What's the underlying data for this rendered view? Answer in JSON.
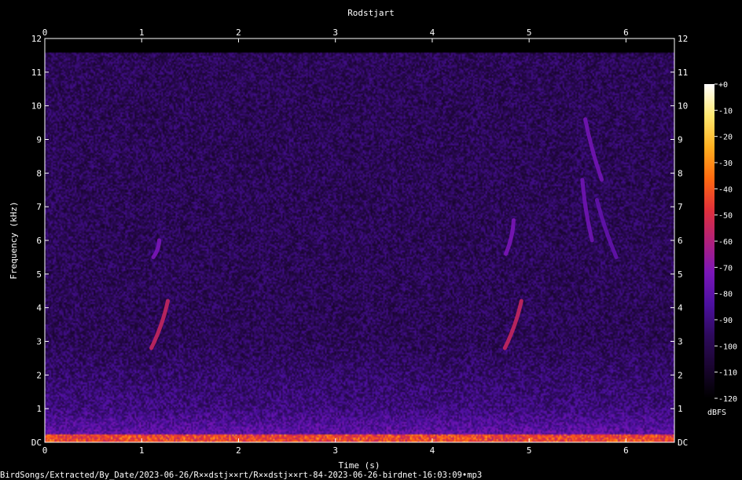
{
  "chart_data": {
    "type": "heatmap",
    "title": "Rodstjart",
    "xlabel": "Time (s)",
    "ylabel": "Frequency (kHz)",
    "xlim": [
      0,
      6.5
    ],
    "ylim": [
      0,
      12
    ],
    "x_ticks": [
      "0",
      "1",
      "2",
      "3",
      "4",
      "5",
      "6"
    ],
    "x_tick_values": [
      0,
      1,
      2,
      3,
      4,
      5,
      6
    ],
    "y_ticks": [
      "DC",
      "1",
      "2",
      "3",
      "4",
      "5",
      "6",
      "7",
      "8",
      "9",
      "10",
      "11",
      "12"
    ],
    "y_tick_values": [
      0,
      1,
      2,
      3,
      4,
      5,
      6,
      7,
      8,
      9,
      10,
      11,
      12
    ],
    "signal_top_khz": 11.6,
    "colorbar": {
      "unit": "dBFS",
      "range": [
        -120,
        0
      ],
      "tick_labels": [
        "+0",
        "-10",
        "-20",
        "-30",
        "-40",
        "-50",
        "-60",
        "-70",
        "-80",
        "-90",
        "-100",
        "-110",
        "-120"
      ],
      "tick_values": [
        0,
        -10,
        -20,
        -30,
        -40,
        -50,
        -60,
        -70,
        -80,
        -90,
        -100,
        -110,
        -120
      ],
      "colormap": [
        "#000000",
        "#1a0530",
        "#2d0a5c",
        "#4c10a0",
        "#7a16b8",
        "#b0207a",
        "#e0303a",
        "#ff6a10",
        "#ffb020",
        "#ffe870",
        "#ffffff"
      ]
    },
    "calls": [
      {
        "t0": 1.1,
        "f0": 2.8,
        "t1": 1.27,
        "f1": 4.2,
        "level_db": -55
      },
      {
        "t0": 1.12,
        "f0": 5.5,
        "t1": 1.18,
        "f1": 6.0,
        "level_db": -72
      },
      {
        "t0": 4.75,
        "f0": 2.8,
        "t1": 4.92,
        "f1": 4.2,
        "level_db": -55
      },
      {
        "t0": 4.76,
        "f0": 5.6,
        "t1": 4.84,
        "f1": 6.6,
        "level_db": -72
      },
      {
        "t0": 5.58,
        "f0": 9.6,
        "t1": 5.75,
        "f1": 7.8,
        "level_db": -74
      },
      {
        "t0": 5.55,
        "f0": 7.8,
        "t1": 5.65,
        "f1": 6.0,
        "level_db": -75
      },
      {
        "t0": 5.7,
        "f0": 7.2,
        "t1": 5.9,
        "f1": 5.5,
        "level_db": -78
      }
    ],
    "filename": "BirdSongs/Extracted/By_Date/2023-06-26/R××dstj××rt/R××dstj××rt-84-2023-06-26-birdnet-16:03:09•mp3"
  }
}
